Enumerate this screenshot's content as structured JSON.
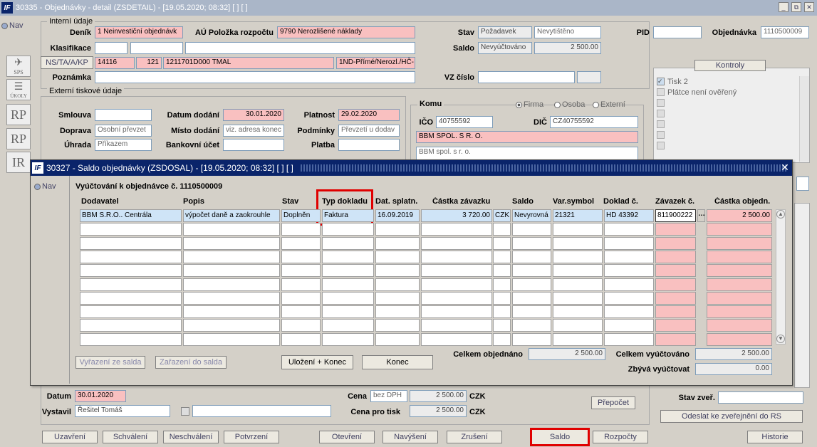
{
  "main_window": {
    "title": "30335 - Objednávky - detail (ZSDETAIL) - [19.05.2020; 08:32]  [ ]  [ ]",
    "controls": [
      "_",
      "⧉",
      "✕"
    ]
  },
  "nav": "Nav",
  "sidebar": {
    "sps": "SPS",
    "ukoly": "ÚKOLY",
    "rp1": "RP",
    "rp2": "RP",
    "ir": "IR"
  },
  "internal": {
    "title": "Interní údaje",
    "denik_label": "Deník",
    "denik": "1 Neinvestiční objednávk",
    "au_label": "AÚ Položka rozpočtu",
    "au": "9790 Nerozlišené náklady",
    "klas_label": "Klasifikace",
    "ns_button": "NS/TA/A/KP",
    "ns1": "14116",
    "ns2": "121",
    "ns3": "1211701D000 TMAL",
    "ns4": "1ND-Přímé/Nerozl./HČ-",
    "poznamka_label": "Poznámka",
    "stav_label": "Stav",
    "stav1": "Požadavek",
    "stav2": "Nevytištěno",
    "saldo_label": "Saldo",
    "saldo1": "Nevyúčtováno",
    "saldo2": "2 500.00",
    "vz_label": "VZ číslo",
    "pid_label": "PID",
    "obj_label": "Objednávka",
    "obj": "1110500009"
  },
  "external": {
    "title": "Externí tiskové údaje",
    "smlouva_label": "Smlouva",
    "datum_label": "Datum dodání",
    "datum": "30.01.2020",
    "platnost_label": "Platnost",
    "platnost": "29.02.2020",
    "doprava_label": "Doprava",
    "doprava": "Osobní převzet",
    "misto_label": "Místo dodání",
    "misto": "viz. adresa konec",
    "podminky_label": "Podmínky",
    "podminky": "Převzetí u dodav",
    "uhrada_label": "Úhrada",
    "uhrada": "Příkazem",
    "bank_label": "Bankovní účet",
    "platba_label": "Platba"
  },
  "komu": {
    "title": "Komu",
    "firma": "Firma",
    "osoba": "Osoba",
    "externi": "Externí",
    "ico_label": "IČO",
    "ico": "40755592",
    "dic_label": "DIČ",
    "dic": "CZ40755592",
    "name": "BBM SPOL. S R. O.",
    "name2": "BBM spol. s r. o."
  },
  "kontroly": {
    "title": "Kontroly",
    "items": [
      "Tisk 2",
      "Plátce není ověřený",
      "",
      "",
      "",
      "",
      "",
      ""
    ]
  },
  "bottom": {
    "datum_label": "Datum",
    "datum": "30.01.2020",
    "vystavil_label": "Vystavil",
    "vystavil": "Řešitel Tomáš",
    "cena_label": "Cena",
    "cena_type": "bez DPH",
    "cena": "2 500.00",
    "czk": "CZK",
    "cena_tisk_label": "Cena pro tisk",
    "cena_tisk": "2 500.00",
    "prepocet": "Přepočet",
    "stav_zver_label": "Stav zveř.",
    "odeslat": "Odeslat ke zveřejnění do RS"
  },
  "toolbar": [
    "Uzavření",
    "Schválení",
    "Neschválení",
    "Potvrzení",
    "Otevření",
    "Navýšení",
    "Zrušení",
    "Saldo",
    "Rozpočty",
    "Historie"
  ],
  "dialog": {
    "title": "30327 - Saldo objednávky (ZSDOSAL) - [19.05.2020; 08:32]  [ ]  [ ]",
    "nav": "Nav",
    "heading": "Vyúčtování k objednávce č. 1110500009",
    "columns": [
      "Dodavatel",
      "Popis",
      "Stav",
      "Typ dokladu",
      "Dat. splatn.",
      "Částka závazku",
      "",
      "Saldo",
      "Var.symbol",
      "Doklad č.",
      "Závazek č.",
      "",
      "Částka objedn."
    ],
    "row": [
      "BBM S.R.O.. Centrála",
      "výpočet daně a zaokrouhle",
      "Doplněn",
      "Faktura",
      "16.09.2019",
      "3 720.00",
      "CZK",
      "Nevyrovná",
      "21321",
      "HD 43392",
      "811900222",
      "…",
      "2 500.00"
    ],
    "btn_vyrazeni": "Vyřazení ze salda",
    "btn_zarazeni": "Zařazení do salda",
    "btn_ulozeni": "Uložení + Konec",
    "btn_konec": "Konec",
    "celkem_obj_label": "Celkem objednáno",
    "celkem_obj": "2 500.00",
    "celkem_vyuct_label": "Celkem vyúčtováno",
    "celkem_vyuct": "2 500.00",
    "zbyva_label": "Zbývá vyúčtovat",
    "zbyva": "0.00"
  }
}
